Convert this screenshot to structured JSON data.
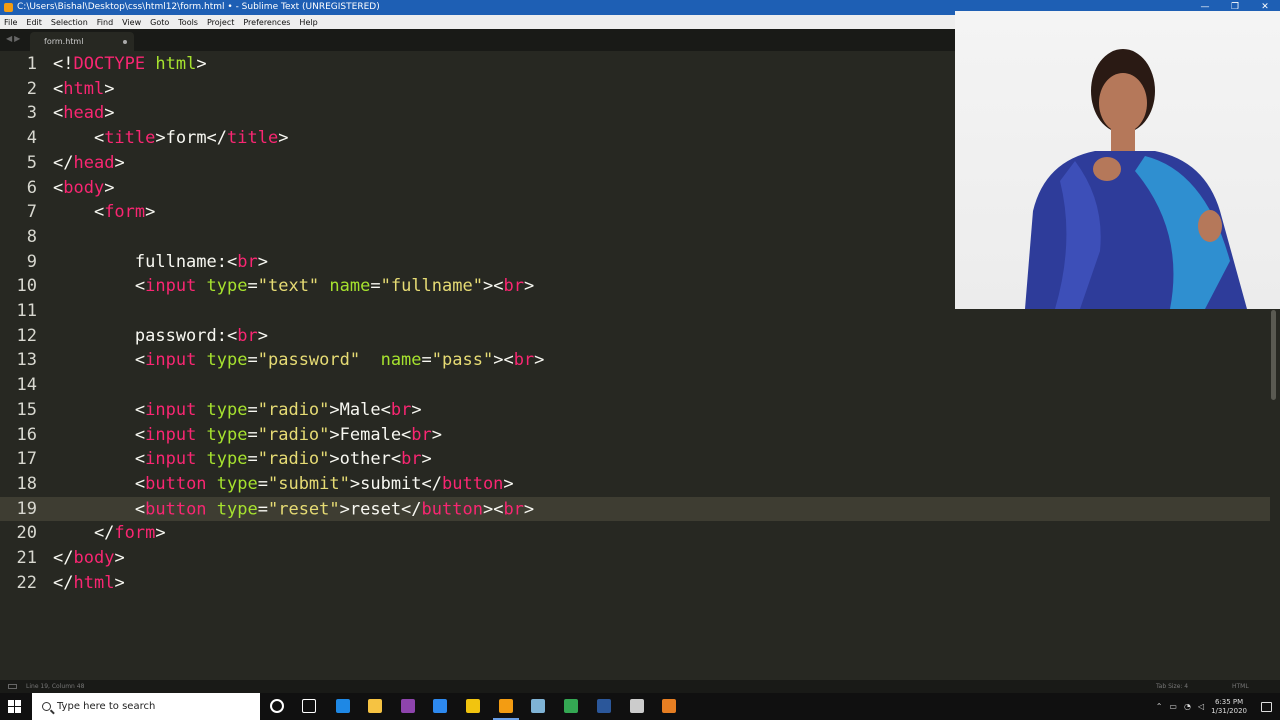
{
  "window": {
    "title": "C:\\Users\\Bishal\\Desktop\\css\\html12\\form.html • - Sublime Text (UNREGISTERED)",
    "controls": [
      "—",
      "❐",
      "✕"
    ]
  },
  "menu": [
    "File",
    "Edit",
    "Selection",
    "Find",
    "View",
    "Goto",
    "Tools",
    "Project",
    "Preferences",
    "Help"
  ],
  "tab": {
    "label": "form.html"
  },
  "editor": {
    "lines": [
      {
        "n": "1",
        "t": [
          [
            "<!",
            "#f8f8f2"
          ],
          [
            "DOCTYPE",
            "#f92672"
          ],
          [
            " html",
            "#a6e22e"
          ],
          [
            ">",
            "#f8f8f2"
          ]
        ]
      },
      {
        "n": "2",
        "t": [
          [
            "<",
            "#f8f8f2"
          ],
          [
            "html",
            "#f92672"
          ],
          [
            ">",
            "#f8f8f2"
          ]
        ]
      },
      {
        "n": "3",
        "t": [
          [
            "<",
            "#f8f8f2"
          ],
          [
            "head",
            "#f92672"
          ],
          [
            ">",
            "#f8f8f2"
          ]
        ]
      },
      {
        "n": "4",
        "t": [
          [
            "    <",
            "#f8f8f2"
          ],
          [
            "title",
            "#f92672"
          ],
          [
            ">form</",
            "#f8f8f2"
          ],
          [
            "title",
            "#f92672"
          ],
          [
            ">",
            "#f8f8f2"
          ]
        ]
      },
      {
        "n": "5",
        "t": [
          [
            "</",
            "#f8f8f2"
          ],
          [
            "head",
            "#f92672"
          ],
          [
            ">",
            "#f8f8f2"
          ]
        ]
      },
      {
        "n": "6",
        "t": [
          [
            "<",
            "#f8f8f2"
          ],
          [
            "body",
            "#f92672"
          ],
          [
            ">",
            "#f8f8f2"
          ]
        ]
      },
      {
        "n": "7",
        "t": [
          [
            "    <",
            "#f8f8f2"
          ],
          [
            "form",
            "#f92672"
          ],
          [
            ">",
            "#f8f8f2"
          ]
        ]
      },
      {
        "n": "8",
        "t": []
      },
      {
        "n": "9",
        "t": [
          [
            "        fullname:<",
            "#f8f8f2"
          ],
          [
            "br",
            "#f92672"
          ],
          [
            ">",
            "#f8f8f2"
          ]
        ]
      },
      {
        "n": "10",
        "t": [
          [
            "        <",
            "#f8f8f2"
          ],
          [
            "input",
            "#f92672"
          ],
          [
            " type",
            "#a6e22e"
          ],
          [
            "=",
            "#f8f8f2"
          ],
          [
            "\"text\"",
            "#e6db74"
          ],
          [
            " name",
            "#a6e22e"
          ],
          [
            "=",
            "#f8f8f2"
          ],
          [
            "\"fullname\"",
            "#e6db74"
          ],
          [
            "><",
            "#f8f8f2"
          ],
          [
            "br",
            "#f92672"
          ],
          [
            ">",
            "#f8f8f2"
          ]
        ]
      },
      {
        "n": "11",
        "t": []
      },
      {
        "n": "12",
        "t": [
          [
            "        password:<",
            "#f8f8f2"
          ],
          [
            "br",
            "#f92672"
          ],
          [
            ">",
            "#f8f8f2"
          ]
        ]
      },
      {
        "n": "13",
        "t": [
          [
            "        <",
            "#f8f8f2"
          ],
          [
            "input",
            "#f92672"
          ],
          [
            " type",
            "#a6e22e"
          ],
          [
            "=",
            "#f8f8f2"
          ],
          [
            "\"password\"",
            "#e6db74"
          ],
          [
            "  name",
            "#a6e22e"
          ],
          [
            "=",
            "#f8f8f2"
          ],
          [
            "\"pass\"",
            "#e6db74"
          ],
          [
            "><",
            "#f8f8f2"
          ],
          [
            "br",
            "#f92672"
          ],
          [
            ">",
            "#f8f8f2"
          ]
        ]
      },
      {
        "n": "14",
        "t": []
      },
      {
        "n": "15",
        "t": [
          [
            "        <",
            "#f8f8f2"
          ],
          [
            "input",
            "#f92672"
          ],
          [
            " type",
            "#a6e22e"
          ],
          [
            "=",
            "#f8f8f2"
          ],
          [
            "\"radio\"",
            "#e6db74"
          ],
          [
            ">Male<",
            "#f8f8f2"
          ],
          [
            "br",
            "#f92672"
          ],
          [
            ">",
            "#f8f8f2"
          ]
        ]
      },
      {
        "n": "16",
        "t": [
          [
            "        <",
            "#f8f8f2"
          ],
          [
            "input",
            "#f92672"
          ],
          [
            " type",
            "#a6e22e"
          ],
          [
            "=",
            "#f8f8f2"
          ],
          [
            "\"radio\"",
            "#e6db74"
          ],
          [
            ">Female<",
            "#f8f8f2"
          ],
          [
            "br",
            "#f92672"
          ],
          [
            ">",
            "#f8f8f2"
          ]
        ]
      },
      {
        "n": "17",
        "t": [
          [
            "        <",
            "#f8f8f2"
          ],
          [
            "input",
            "#f92672"
          ],
          [
            " type",
            "#a6e22e"
          ],
          [
            "=",
            "#f8f8f2"
          ],
          [
            "\"radio\"",
            "#e6db74"
          ],
          [
            ">other<",
            "#f8f8f2"
          ],
          [
            "br",
            "#f92672"
          ],
          [
            ">",
            "#f8f8f2"
          ]
        ]
      },
      {
        "n": "18",
        "t": [
          [
            "        <",
            "#f8f8f2"
          ],
          [
            "button",
            "#f92672"
          ],
          [
            " type",
            "#a6e22e"
          ],
          [
            "=",
            "#f8f8f2"
          ],
          [
            "\"submit\"",
            "#e6db74"
          ],
          [
            ">submit</",
            "#f8f8f2"
          ],
          [
            "button",
            "#f92672"
          ],
          [
            ">",
            "#f8f8f2"
          ]
        ]
      },
      {
        "n": "19",
        "t": [
          [
            "        <",
            "#f8f8f2"
          ],
          [
            "button",
            "#f92672"
          ],
          [
            " type",
            "#a6e22e"
          ],
          [
            "=",
            "#f8f8f2"
          ],
          [
            "\"reset\"",
            "#e6db74"
          ],
          [
            ">reset</",
            "#f8f8f2"
          ],
          [
            "button",
            "#f92672"
          ],
          [
            "><",
            "#f8f8f2"
          ],
          [
            "br",
            "#f92672"
          ],
          [
            ">",
            "#f8f8f2"
          ]
        ],
        "current": true
      },
      {
        "n": "20",
        "t": [
          [
            "    </",
            "#f8f8f2"
          ],
          [
            "form",
            "#f92672"
          ],
          [
            ">",
            "#f8f8f2"
          ]
        ]
      },
      {
        "n": "21",
        "t": [
          [
            "</",
            "#f8f8f2"
          ],
          [
            "body",
            "#f92672"
          ],
          [
            ">",
            "#f8f8f2"
          ]
        ]
      },
      {
        "n": "22",
        "t": [
          [
            "</",
            "#f8f8f2"
          ],
          [
            "html",
            "#f92672"
          ],
          [
            ">",
            "#f8f8f2"
          ]
        ]
      }
    ]
  },
  "status": {
    "position": "Line 19, Column 48",
    "tab_size": "Tab Size: 4",
    "syntax": "HTML"
  },
  "taskbar": {
    "search_placeholder": "Type here to search",
    "time": "6:35 PM",
    "date": "1/31/2020",
    "icons": [
      {
        "name": "cortana-icon",
        "color": "#ffffff"
      },
      {
        "name": "task-view-icon",
        "color": "#ffffff"
      },
      {
        "name": "edge-icon",
        "color": "#1e88e5"
      },
      {
        "name": "file-explorer-icon",
        "color": "#f6c342"
      },
      {
        "name": "visual-studio-icon",
        "color": "#8e44ad"
      },
      {
        "name": "store-icon",
        "color": "#2d89ef"
      },
      {
        "name": "python-icon",
        "color": "#f1c40f"
      },
      {
        "name": "sublime-text-icon",
        "color": "#f39c12"
      },
      {
        "name": "app-icon",
        "color": "#7fb3d5"
      },
      {
        "name": "chrome-icon",
        "color": "#34a853"
      },
      {
        "name": "word-icon",
        "color": "#2b579a"
      },
      {
        "name": "photos-icon",
        "color": "#cccccc"
      },
      {
        "name": "orange-app-icon",
        "color": "#e67e22"
      }
    ]
  },
  "colors": {
    "bg": "#272822",
    "tag": "#f92672",
    "attr": "#a6e22e",
    "string": "#e6db74",
    "text": "#f8f8f2",
    "titlebar": "#1e5fb4"
  }
}
